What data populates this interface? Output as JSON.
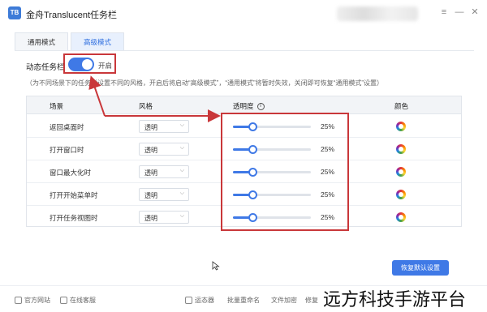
{
  "app": {
    "logo_text": "TB",
    "title": "金舟Translucent任务栏"
  },
  "window": {
    "menu_icon": "≡",
    "minimize_icon": "—",
    "close_icon": "✕"
  },
  "tabs": [
    {
      "label": "通用模式",
      "active": false
    },
    {
      "label": "高级模式",
      "active": true
    }
  ],
  "dynamic_taskbar": {
    "label": "动态任务栏",
    "state_label": "开启",
    "enabled": true
  },
  "hint": "（为不同场景下的任务栏设置不同的风格，开启后将启动“高级模式”，“通用模式”将暂时失效，关闭即可恢复“通用模式”设置）",
  "table": {
    "headers": {
      "scene": "场景",
      "style": "风格",
      "opacity": "透明度",
      "opacity_info": "i",
      "color": "颜色"
    },
    "rows": [
      {
        "scene": "返回桌面时",
        "style": "透明",
        "opacity_value": 25,
        "opacity_label": "25%"
      },
      {
        "scene": "打开窗口时",
        "style": "透明",
        "opacity_value": 25,
        "opacity_label": "25%"
      },
      {
        "scene": "窗口最大化时",
        "style": "透明",
        "opacity_value": 25,
        "opacity_label": "25%"
      },
      {
        "scene": "打开开始菜单时",
        "style": "透明",
        "opacity_value": 25,
        "opacity_label": "25%"
      },
      {
        "scene": "打开任务视图时",
        "style": "透明",
        "opacity_value": 25,
        "opacity_label": "25%"
      }
    ],
    "select_arrow": "⌵"
  },
  "reset_button": "恢复默认设置",
  "footer": {
    "items": [
      "官方网站",
      "在线客服",
      "运态器",
      "批量重命名",
      "文件加密",
      "修复"
    ]
  },
  "watermark": "远方科技手游平台",
  "colors": {
    "accent": "#3f79e6",
    "highlight": "#c9373a"
  }
}
